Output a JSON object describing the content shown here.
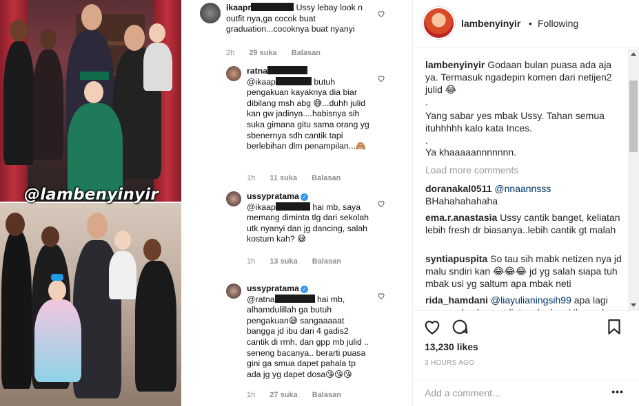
{
  "post": {
    "watermark": "@lambenyinyir"
  },
  "screenshot_comments": [
    {
      "username": "ikaapr",
      "text": "Ussy lebay look n outfit nya,ga cocok buat graduation...cocoknya buat nyanyi",
      "time": "2h",
      "likes": "29 suka",
      "reply": "Balasan"
    },
    {
      "username": "ratna",
      "mention": "@ikaap",
      "text": "butuh pengakuan kayaknya dia biar dibilang msh abg 😅...duhh julid kan gw jadinya....habisnya sih suka gimana gitu sama orang yg sbenernya sdh cantik tapi berlebihan dlm penampilan...🙈",
      "time": "1h",
      "likes": "11 suka",
      "reply": "Balasan"
    },
    {
      "username": "ussypratama",
      "mention": "@ikaap",
      "text": "hai mb, saya memang diminta tlg dari sekolah utk nyanyi dan jg dancing, salah kostum kah? 😅",
      "time": "1h",
      "likes": "13 suka",
      "reply": "Balasan"
    },
    {
      "username": "ussypratama",
      "mention": "@ratna",
      "text": "hai mb, alhamdulillah ga butuh pengakuan😅 sangaaaaat bangga jd ibu dari 4 gadis2 cantik di rmh, dan gpp mb julid .. seneng bacanya.. berarti puasa gini ga smua dapet pahala tp ada jg yg dapet dosa😘😘😘",
      "time": "1h",
      "likes": "27 suka",
      "reply": "Balasan"
    }
  ],
  "header": {
    "username": "lambenyinyir",
    "separator": "•",
    "follow_status": "Following"
  },
  "caption": {
    "username": "lambenyinyir",
    "line1": "Godaan bulan puasa ada aja ya. Termasuk ngadepin komen dari netijen2 julid 😂",
    "dot1": ".",
    "line2": "Yang sabar yes mbak Ussy. Tahan semua ituhhhhh kalo kata Inces.",
    "dot2": ".",
    "line3": "Ya khaaaaannnnnnn."
  },
  "load_more": "Load more comments",
  "comments": [
    {
      "username": "doranakal0511",
      "mention": "@nnaannsss",
      "text": "BHahahahahaha"
    },
    {
      "username": "ema.r.anastasia",
      "mention": "",
      "text": "Ussy cantik banget, keliatan lebih fresh dr biasanya..lebih cantik gt malah"
    },
    {
      "username": "syntiapuspita",
      "mention": "",
      "text": "So tau sih mabk netizen nya jd malu sndiri kan 😂😂😂 jd yg salah siapa tuh mbak usi yg saltum apa mbak neti"
    },
    {
      "username": "rida_hamdani",
      "mention": "@liayulianingsih99",
      "text": "apa lagi saya males banget liat muka lu... Ukaaaak"
    }
  ],
  "actions": {
    "likes": "13,230 likes",
    "time": "3 HOURS AGO",
    "add_comment_placeholder": "Add a comment...",
    "more": "•••"
  },
  "icons": {
    "like": "heart-icon",
    "comment": "comment-icon",
    "save": "bookmark-icon",
    "options": "more-options-icon"
  }
}
